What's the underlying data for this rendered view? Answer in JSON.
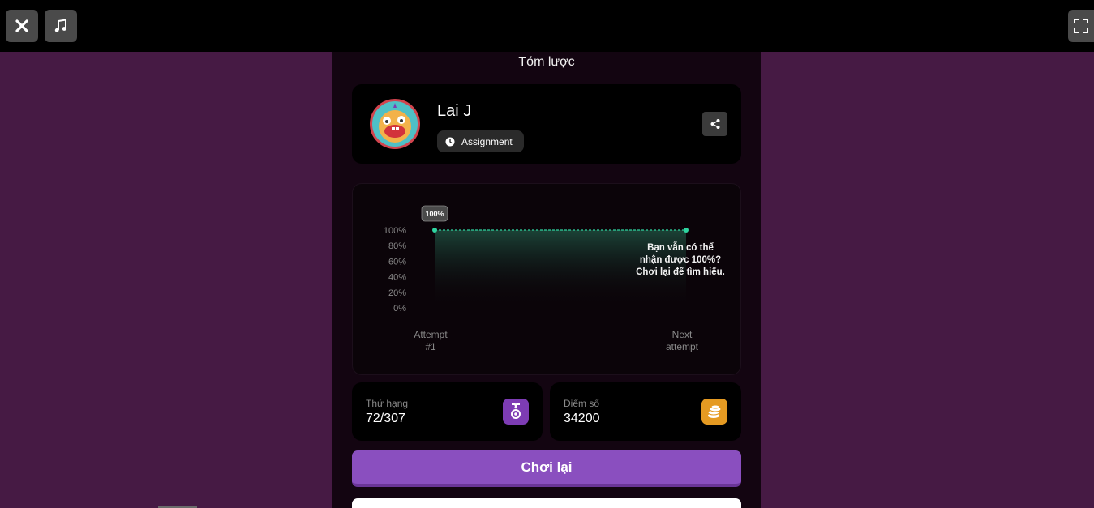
{
  "toolbar": {
    "close_icon": "close-icon",
    "music_icon": "music-icon",
    "fullscreen_icon": "fullscreen-icon"
  },
  "summary": {
    "title": "Tóm lược"
  },
  "player": {
    "name": "Lai J",
    "mode_label": "Assignment",
    "mode_icon": "clock-icon",
    "share_icon": "share-icon"
  },
  "chart_data": {
    "type": "area",
    "categories": [
      "Attempt #1",
      "Next attempt"
    ],
    "x_labels": [
      [
        "Attempt",
        "#1"
      ],
      [
        "Next",
        "attempt"
      ]
    ],
    "values": [
      100,
      100
    ],
    "y_ticks": [
      "100%",
      "80%",
      "60%",
      "40%",
      "20%",
      "0%"
    ],
    "ylim": [
      0,
      100
    ],
    "data_label": "100%",
    "annotation": [
      "Bạn vẫn có thể",
      "nhận được 100%?",
      "Chơi lại để tìm hiểu."
    ],
    "line_color": "#2fd4a0",
    "grid": false
  },
  "stats": {
    "rank_label": "Thứ hạng",
    "rank_value": "72/307",
    "rank_icon": "medal-icon",
    "score_label": "Điểm số",
    "score_value": "34200",
    "score_icon": "coins-icon"
  },
  "actions": {
    "play_again_label": "Chơi lại"
  },
  "colors": {
    "background": "#461a44",
    "panel": "#130511",
    "accent": "#8a4fbf",
    "score_icon_bg": "#e59a22",
    "rank_icon_bg": "#7d3cb4"
  }
}
